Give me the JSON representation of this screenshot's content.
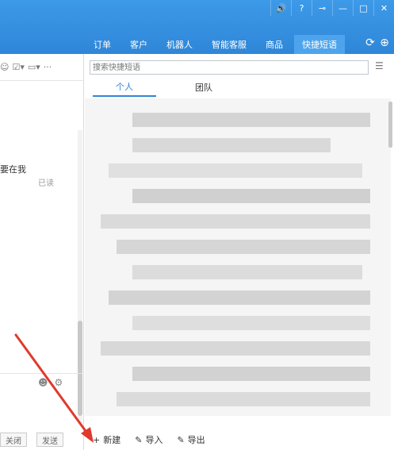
{
  "window": {
    "controls": [
      "🔊",
      "?",
      "⊸",
      "—",
      "□",
      "✕"
    ]
  },
  "nav": {
    "items": [
      "订单",
      "客户",
      "机器人",
      "智能客服",
      "商品",
      "快捷短语"
    ],
    "active_index": 5,
    "icons": [
      "refresh-icon",
      "plus-circle-icon"
    ]
  },
  "chat": {
    "message_text": "要在我",
    "read_status": "已读",
    "close_button": "关闭",
    "send_button": "发送"
  },
  "quick_phrases": {
    "search_placeholder": "搜索快捷短语",
    "tabs": [
      "个人",
      "团队"
    ],
    "active_tab": 0,
    "new_label": "新建",
    "import_label": "导入",
    "export_label": "导出"
  },
  "colors": {
    "brand_blue": "#2f86d8",
    "annotation_red": "#e03a2c"
  }
}
